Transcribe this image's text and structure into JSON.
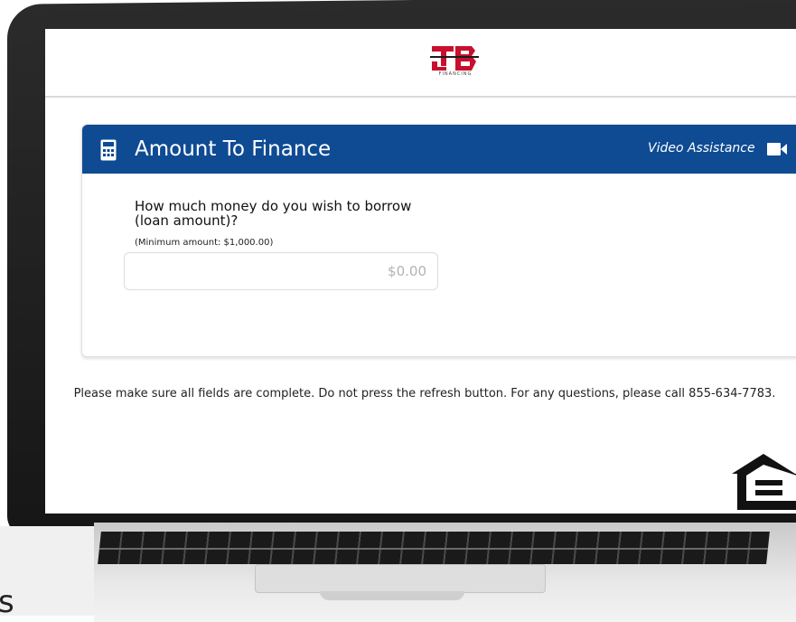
{
  "brand": {
    "logo_letters": "JB",
    "logo_caption": "FINANCING"
  },
  "card": {
    "title": "Amount To Finance",
    "video_link": "Video Assistance",
    "question": "How much money do you wish to borrow (loan amount)?",
    "hint": "(Minimum amount: $1,000.00)",
    "amount_placeholder": "$0.00"
  },
  "footer": {
    "note": "Please make sure all fields are complete. Do not press the refresh button. For any questions, please call 855-634-7783."
  },
  "cutoff_left_text": "s",
  "colors": {
    "header_blue": "#0e4b93",
    "logo_red": "#c8102e"
  },
  "icons": [
    "calculator-icon",
    "video-camera-icon",
    "equal-housing-opportunity-icon"
  ]
}
